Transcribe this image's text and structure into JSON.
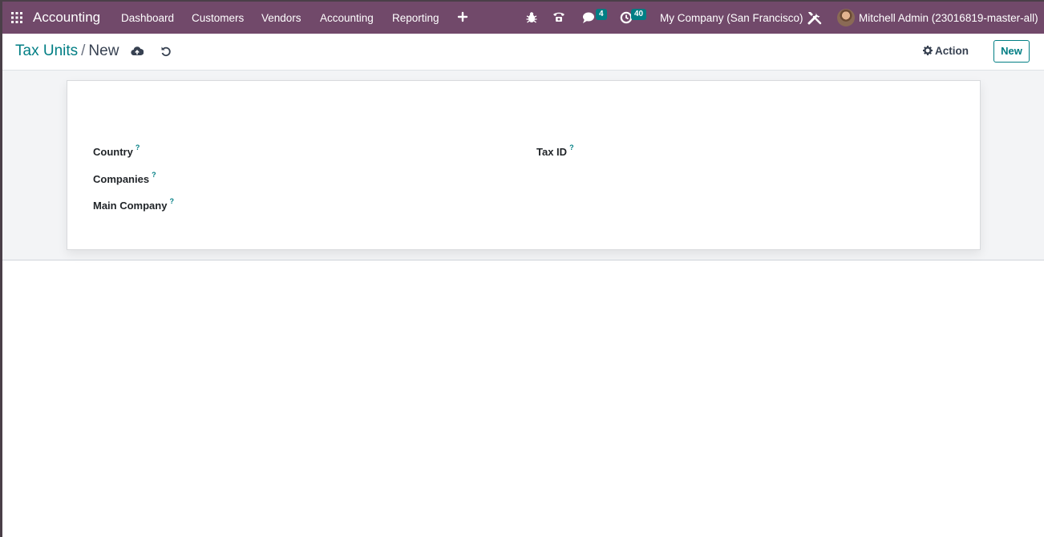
{
  "navbar": {
    "app_title": "Accounting",
    "menus": [
      "Dashboard",
      "Customers",
      "Vendors",
      "Accounting",
      "Reporting"
    ],
    "messages_count": "4",
    "activities_count": "40",
    "company": "My Company (San Francisco)",
    "user": "Mitchell Admin (23016819-master-all)"
  },
  "breadcrumb": {
    "parent": "Tax Units",
    "separator": "/",
    "current": "New"
  },
  "control_panel": {
    "action_label": "Action",
    "new_label": "New"
  },
  "form": {
    "country_label": "Country",
    "companies_label": "Companies",
    "main_company_label": "Main Company",
    "tax_id_label": "Tax ID",
    "help_marker": "?"
  },
  "colors": {
    "navbar": "#71496a",
    "accent": "#017e84",
    "background": "#f3f4f6"
  }
}
